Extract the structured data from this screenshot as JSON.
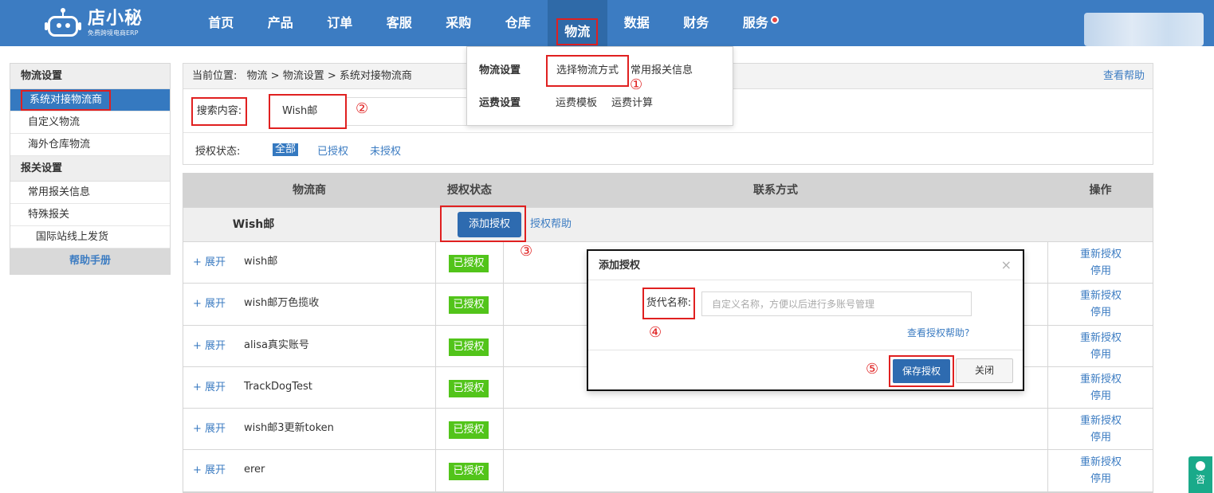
{
  "brand": {
    "name": "店小秘",
    "tagline": "免费跨境电商ERP"
  },
  "nav": {
    "items": [
      "首页",
      "产品",
      "订单",
      "客服",
      "采购",
      "仓库",
      "物流",
      "数据",
      "财务",
      "服务"
    ],
    "active": "物流"
  },
  "sidebar": {
    "sections": [
      {
        "title": "物流设置",
        "items": [
          "系统对接物流商",
          "自定义物流",
          "海外仓库物流"
        ]
      },
      {
        "title": "报关设置",
        "items": [
          "常用报关信息",
          "特殊报关",
          "国际站线上发货"
        ]
      }
    ],
    "help": "帮助手册"
  },
  "breadcrumb": {
    "prefix": "当前位置:",
    "path": "物流 > 物流设置 > 系统对接物流商",
    "help": "查看帮助"
  },
  "search": {
    "label": "搜索内容:",
    "value": "Wish邮"
  },
  "auth_filter": {
    "label": "授权状态:",
    "options": [
      "全部",
      "已授权",
      "未授权"
    ]
  },
  "table": {
    "headers": [
      "物流商",
      "授权状态",
      "联系方式",
      "操作"
    ],
    "group": {
      "name": "Wish邮",
      "add_button": "添加授权",
      "help_link": "授权帮助"
    },
    "expand_label": "+ 展开",
    "rows": [
      {
        "name": "wish邮",
        "status": "已授权",
        "op1": "重新授权",
        "op2": "停用"
      },
      {
        "name": "wish邮万色揽收",
        "status": "已授权",
        "op1": "重新授权",
        "op2": "停用"
      },
      {
        "name": "alisa真实账号",
        "status": "已授权",
        "op1": "重新授权",
        "op2": "停用"
      },
      {
        "name": "TrackDogTest",
        "status": "已授权",
        "op1": "重新授权",
        "op2": "停用"
      },
      {
        "name": "wish邮3更新token",
        "status": "已授权",
        "op1": "重新授权",
        "op2": "停用"
      },
      {
        "name": "erer",
        "status": "已授权",
        "op1": "重新授权",
        "op2": "停用"
      }
    ]
  },
  "dropdown": {
    "row1": {
      "head": "物流设置",
      "links": [
        "选择物流方式",
        "常用报关信息"
      ]
    },
    "row2": {
      "head": "运费设置",
      "links": [
        "运费模板",
        "运费计算"
      ]
    }
  },
  "modal": {
    "title": "添加授权",
    "close": "×",
    "field_label": "货代名称:",
    "placeholder": "自定义名称，方便以后进行多账号管理",
    "help_link": "查看授权帮助?",
    "save": "保存授权",
    "cancel": "关闭"
  },
  "steps": [
    "①",
    "②",
    "③",
    "④",
    "⑤"
  ],
  "consult": {
    "label": "咨"
  },
  "colors": {
    "header": "#3c7cc2",
    "accent": "#2e6bb0",
    "authorized": "#52c41a",
    "highlight": "#e02020"
  }
}
